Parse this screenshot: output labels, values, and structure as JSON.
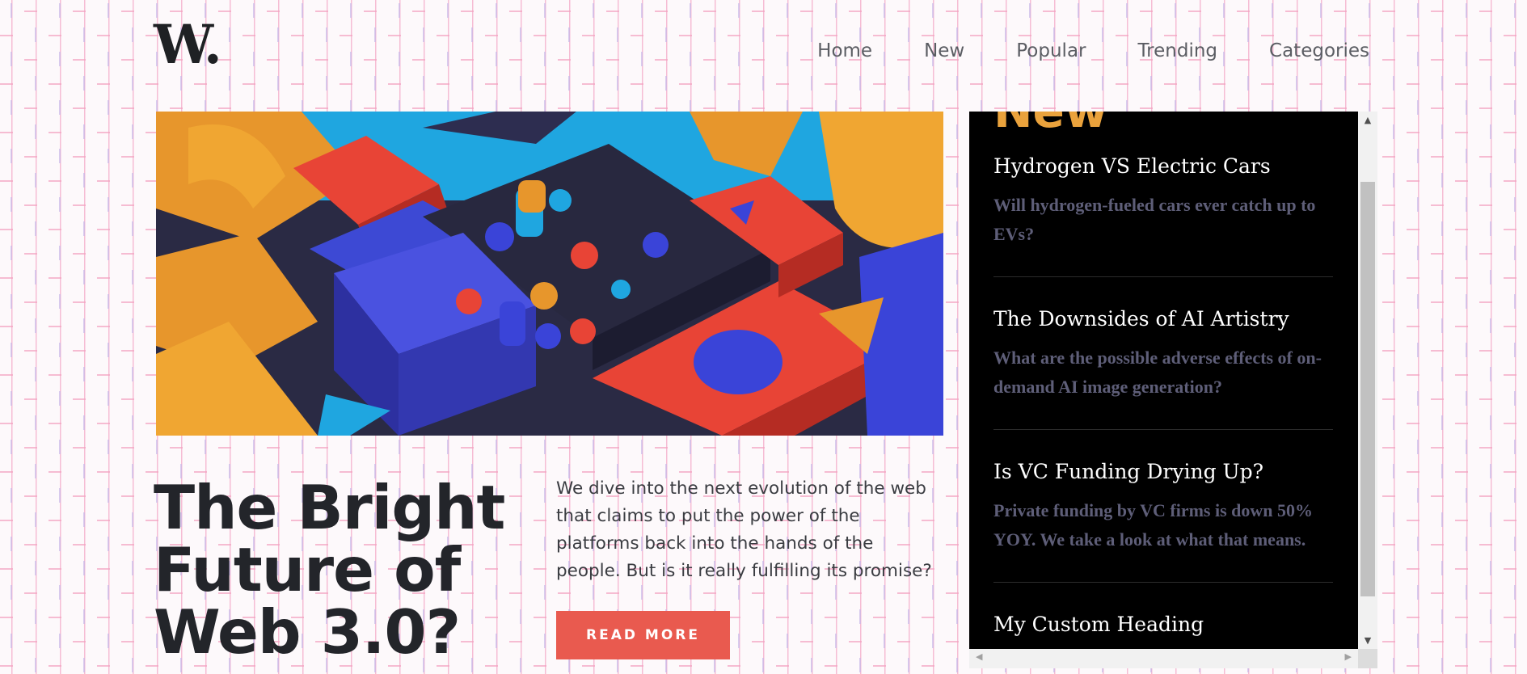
{
  "logo": "W.",
  "nav": [
    {
      "label": "Home"
    },
    {
      "label": "New"
    },
    {
      "label": "Popular"
    },
    {
      "label": "Trending"
    },
    {
      "label": "Categories"
    }
  ],
  "hero": {
    "title": "The Bright Future of Web 3.0?",
    "description": "We dive into the next evolution of the web that claims to put the power of the platforms back into the hands of the people. But is it really fulfilling its promise?",
    "button_label": "READ MORE"
  },
  "new_panel": {
    "heading": "New",
    "articles": [
      {
        "title": "Hydrogen VS Electric Cars",
        "subtitle": "Will hydrogen-fueled cars ever catch up to EVs?"
      },
      {
        "title": "The Downsides of AI Artistry",
        "subtitle": "What are the possible adverse effects of on-demand AI image generation?"
      },
      {
        "title": "Is VC Funding Drying Up?",
        "subtitle": "Private funding by VC firms is down 50% YOY. We take a look at what that means."
      },
      {
        "title": "My Custom Heading",
        "subtitle": ""
      }
    ]
  },
  "colors": {
    "accent_red": "#e95a4f",
    "accent_orange": "#eaa23c",
    "panel_bg": "#000000",
    "subtitle_purple": "#5e5e78"
  },
  "icons": {
    "scroll_up": "triangle-up-icon",
    "scroll_down": "triangle-down-icon",
    "scroll_left": "triangle-left-icon",
    "scroll_right": "triangle-right-icon"
  }
}
